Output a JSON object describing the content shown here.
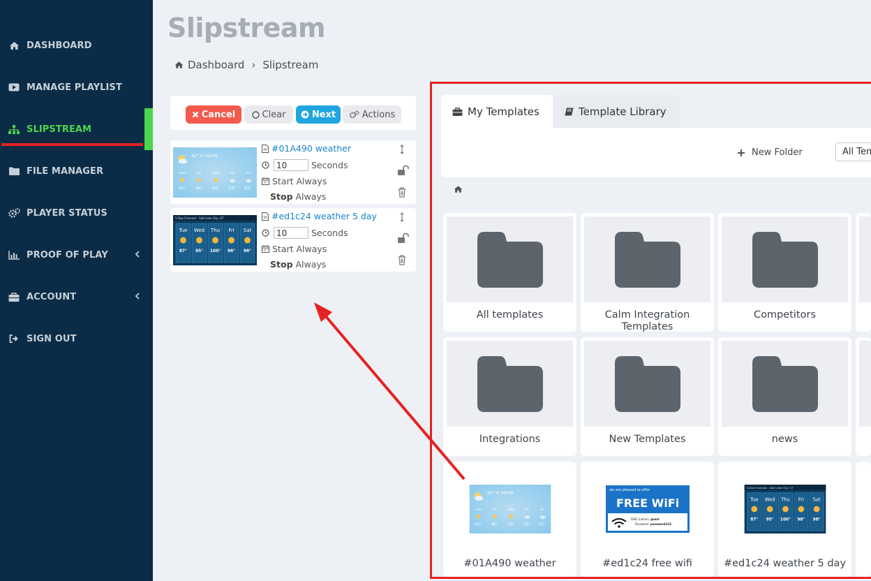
{
  "sidebar": {
    "items": [
      {
        "label": "DASHBOARD",
        "icon": "home-icon"
      },
      {
        "label": "MANAGE PLAYLIST",
        "icon": "play-icon"
      },
      {
        "label": "SLIPSTREAM",
        "icon": "sitemap-icon",
        "active": true
      },
      {
        "label": "FILE MANAGER",
        "icon": "folder-icon"
      },
      {
        "label": "PLAYER STATUS",
        "icon": "gears-icon"
      },
      {
        "label": "PROOF OF PLAY",
        "icon": "bar-chart-icon",
        "expandable": true
      },
      {
        "label": "ACCOUNT",
        "icon": "briefcase-icon",
        "expandable": true
      },
      {
        "label": "SIGN OUT",
        "icon": "sign-out-icon"
      }
    ]
  },
  "page": {
    "title": "Slipstream",
    "breadcrumb": [
      "Dashboard",
      "Slipstream"
    ]
  },
  "toolbar": {
    "cancel": "Cancel",
    "clear": "Clear",
    "next": "Next",
    "actions": "Actions"
  },
  "playlist": [
    {
      "name": "#01A490 weather",
      "duration": "10",
      "duration_unit": "Seconds",
      "start": "Start Always",
      "stop_bold": "Stop",
      "stop_rest": " Always"
    },
    {
      "name": "#ed1c24 weather 5 day",
      "duration": "10",
      "duration_unit": "Seconds",
      "start": "Start Always",
      "stop_bold": "Stop",
      "stop_rest": " Always"
    }
  ],
  "templates": {
    "tabs": [
      "My Templates",
      "Template Library"
    ],
    "new_folder": "New Folder",
    "filter_value": "All Templates",
    "folders": [
      "All templates",
      "Calm Integration Templates",
      "Competitors",
      "Integrations",
      "New Templates",
      "news"
    ],
    "items": [
      "#01A490 weather",
      "#ed1c24 free wifi",
      "#ed1c24 weather 5 day"
    ]
  },
  "thumbs": {
    "weather": {
      "headline": "42° in Sandy",
      "days": [
        "MON",
        "TUE",
        "WED",
        "THU",
        "FRI"
      ],
      "temps": [
        "42°",
        "46°",
        "50°",
        "55°",
        "53°"
      ]
    },
    "five_day": {
      "title": "5-Day Forecast - Salt Lake City, UT",
      "days": [
        "Tue",
        "Wed",
        "Thu",
        "Fri",
        "Sat"
      ],
      "highs": [
        "87°",
        "95°",
        "100°",
        "98°",
        "98°"
      ]
    },
    "wifi": {
      "top": "we are pleased to offer",
      "headline": "FREE WiFi",
      "ssid_label": "SSID (name):",
      "ssid": "guest",
      "password_label": "Password:",
      "password": "password123"
    }
  },
  "colors": {
    "sidebar": "#0b2c46",
    "active": "#4cd54c",
    "cancel": "#f25a4c",
    "next": "#1fa6e0",
    "annotation": "#e52222",
    "link": "#1a86c8"
  }
}
